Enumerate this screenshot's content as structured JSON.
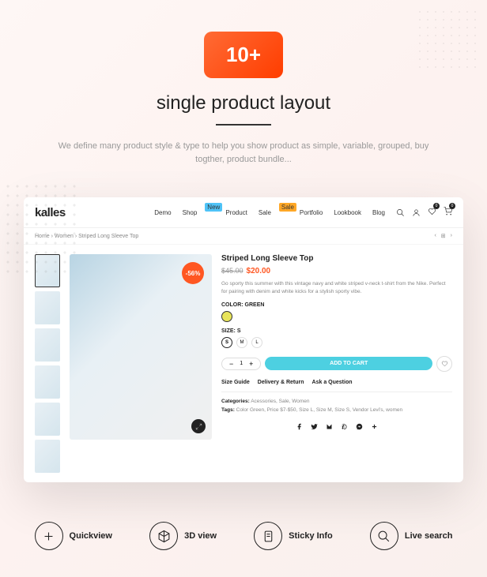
{
  "hero": {
    "badge": "10+",
    "title": "single product layout",
    "subtitle": "We define many product style & type to help you show product as simple, variable, grouped, buy togther, product bundle..."
  },
  "nav": {
    "logo": "kalles",
    "items": [
      "Demo",
      "Shop",
      "Product",
      "Sale",
      "Portfolio",
      "Lookbook",
      "Blog"
    ],
    "tag_new": "New",
    "tag_sale": "Sale"
  },
  "breadcrumb": {
    "path": "Home  ›  Women  ›  Striped Long Sleeve Top"
  },
  "product": {
    "discount": "-56%",
    "title": "Striped Long Sleeve Top",
    "old_price": "$45.00",
    "new_price": "$20.00",
    "description": "Go sporty this summer with this vintage navy and white striped v-neck t-shirt from the Nike. Perfect for pairing with denim and white kicks for a stylish sporty vibe.",
    "color_label": "COLOR: GREEN",
    "size_label": "SIZE: S",
    "sizes": [
      "S",
      "M",
      "L"
    ],
    "qty": "1",
    "add_to_cart": "ADD TO CART",
    "links": [
      "Size Guide",
      "Delivery & Return",
      "Ask a Question"
    ],
    "cat_label": "Categories:",
    "categories": " Acessories, Sale, Women",
    "tag_label": "Tags:",
    "tags": " Color Green, Price $7-$50, Size L, Size M, Size S, Vendor Levi's, women"
  },
  "features": {
    "f1": "Quickview",
    "f2": "3D view",
    "f3": "Sticky Info",
    "f4": "Live search"
  }
}
